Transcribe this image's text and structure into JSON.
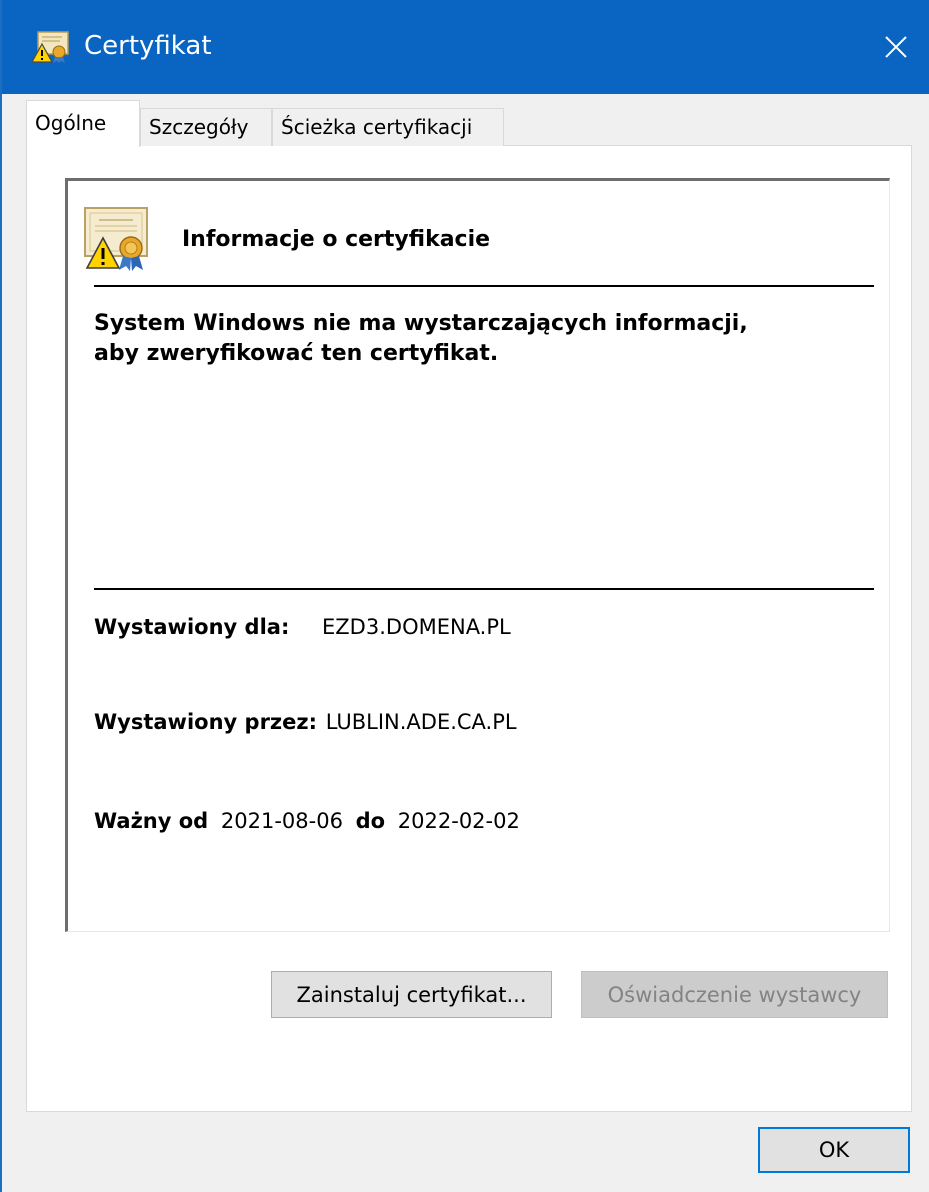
{
  "window": {
    "title": "Certyfikat",
    "title_icon": "certificate-warning-icon",
    "close_icon": "close-icon"
  },
  "tabs": [
    {
      "label": "Ogólne",
      "active": true
    },
    {
      "label": "Szczegóły",
      "active": false
    },
    {
      "label": "Ścieżka certyfikacji",
      "active": false
    }
  ],
  "general": {
    "heading": "Informacje o certyfikacie",
    "warning_line1": "System Windows nie ma wystarczających informacji,",
    "warning_line2": "aby zweryfikować ten certyfikat.",
    "issued_to_label": "Wystawiony dla:",
    "issued_to_value": "EZD3.DOMENA.PL",
    "issued_by_label": "Wystawiony przez:",
    "issued_by_value": "LUBLIN.ADE.CA.PL",
    "valid_from_label": "Ważny od",
    "valid_from_value": "2021-08-06",
    "valid_to_label": "do",
    "valid_to_value": "2022-02-02"
  },
  "buttons": {
    "install": "Zainstaluj certyfikat...",
    "issuer_statement": "Oświadczenie wystawcy",
    "ok": "OK"
  },
  "colors": {
    "titlebar": "#0a64c2",
    "accent": "#0078d7",
    "disabled_text": "#838383"
  }
}
